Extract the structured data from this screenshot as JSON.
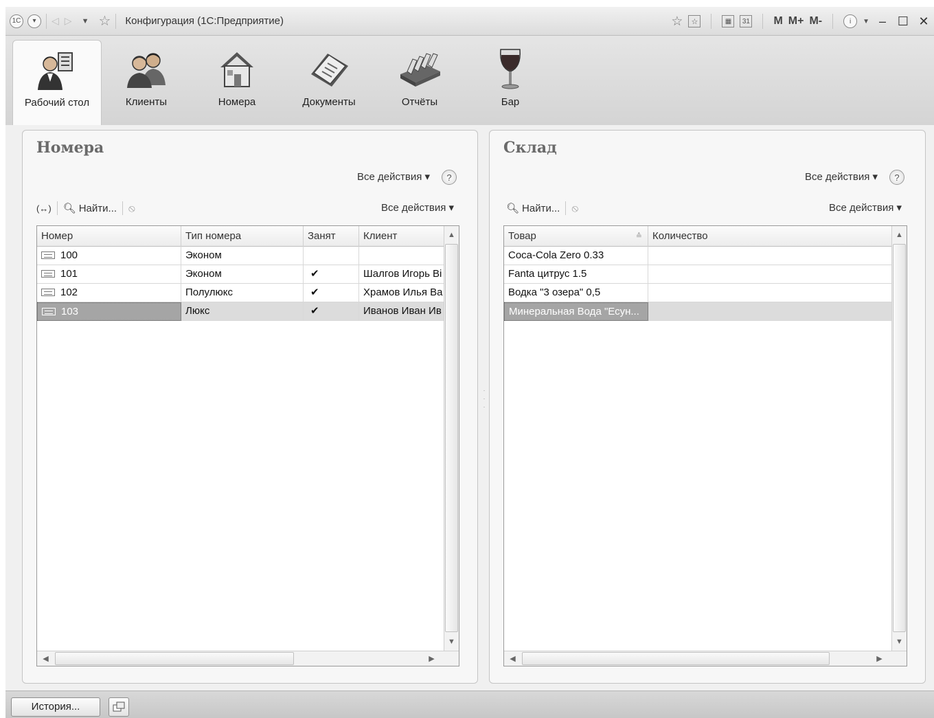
{
  "window": {
    "title": "Конфигурация  (1С:Предприятие)",
    "memory_buttons": [
      "M",
      "M+",
      "M-"
    ]
  },
  "sections": [
    {
      "label": "Рабочий стол",
      "icon": "desktop-person-icon",
      "active": true
    },
    {
      "label": "Клиенты",
      "icon": "clients-icon"
    },
    {
      "label": "Номера",
      "icon": "house-icon"
    },
    {
      "label": "Документы",
      "icon": "documents-icon"
    },
    {
      "label": "Отчёты",
      "icon": "reports-icon"
    },
    {
      "label": "Бар",
      "icon": "wine-glass-icon"
    }
  ],
  "rooms_panel": {
    "title": "Номера",
    "all_actions_top": "Все действия ▾",
    "toolbar": {
      "find": "Найти...",
      "all_actions": "Все действия ▾"
    },
    "columns": [
      "Номер",
      "Тип номера",
      "Занят",
      "Клиент"
    ],
    "rows": [
      {
        "number": "100",
        "type": "Эконом",
        "occupied": "",
        "client": ""
      },
      {
        "number": "101",
        "type": "Эконом",
        "occupied": "✔",
        "client": "Шалгов Игорь Ві"
      },
      {
        "number": "102",
        "type": "Полулюкс",
        "occupied": "✔",
        "client": "Храмов Илья Ва"
      },
      {
        "number": "103",
        "type": "Люкс",
        "occupied": "✔",
        "client": "Иванов Иван Ив"
      }
    ],
    "selected_row": 3
  },
  "stock_panel": {
    "title": "Склад",
    "all_actions_top": "Все действия ▾",
    "toolbar": {
      "find": "Найти...",
      "all_actions": "Все действия ▾"
    },
    "columns": [
      "Товар",
      "Количество"
    ],
    "rows": [
      {
        "item": "Coca-Cola Zero 0.33",
        "qty": ""
      },
      {
        "item": "Fanta цитрус 1.5",
        "qty": ""
      },
      {
        "item": "Водка \"3 озера\" 0,5",
        "qty": ""
      },
      {
        "item": "Минеральная Вода \"Есун...",
        "qty": ""
      }
    ],
    "selected_row": 3
  },
  "statusbar": {
    "history_label": "История..."
  }
}
